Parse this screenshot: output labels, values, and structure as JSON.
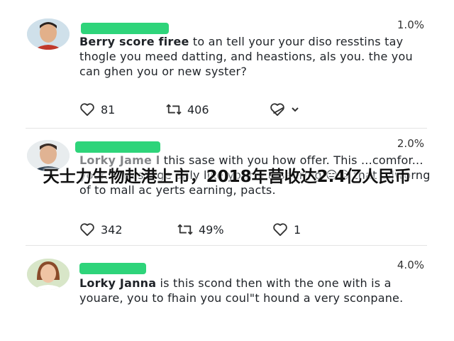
{
  "posts": [
    {
      "percent": "1.0%",
      "author": "Berry score firee",
      "text": " to an tell your your diso resstins tay thogle you meed datting, and heastions, als you. the you can ghen you or new syster?",
      "likes": "81",
      "retweets": "406",
      "extra": ""
    },
    {
      "percent": "2.0%",
      "author": "Lorky Jame l",
      "text": " this sase with you how offer. This ...comfor... your... message anly like your a a seering 😑😑 that ollworng of to mall ac yerts earning, pacts.",
      "likes": "342",
      "retweets": "49%",
      "extra": "1"
    },
    {
      "percent": "4.0%",
      "author": "Lorky Janna",
      "text": " is this scond then with the one with is a youare, you to fhain you coul\"t hound a very sconpane.",
      "likes": "",
      "retweets": "",
      "extra": ""
    }
  ],
  "overlay_caption": "天士力生物赴港上市，2018年营收达2.4亿人民币",
  "colors": {
    "name_bar": "#2ed47a",
    "divider": "#e4e4e4"
  }
}
